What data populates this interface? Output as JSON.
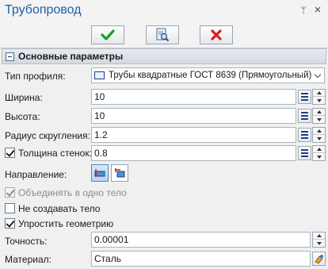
{
  "window": {
    "title": "Трубопровод",
    "pin_glyph": "ᛘ",
    "close_glyph": "×"
  },
  "toolbar": {
    "ok_icon": "checkmark-icon",
    "preview_icon": "preview-icon",
    "cancel_icon": "cross-icon"
  },
  "section": {
    "title": "Основные параметры"
  },
  "fields": {
    "profile_type": {
      "label": "Тип профиля:",
      "value": "Трубы квадратные ГОСТ 8639 (Прямоугольный)"
    },
    "width": {
      "label": "Ширина:",
      "value": "10"
    },
    "height": {
      "label": "Высота:",
      "value": "10"
    },
    "radius": {
      "label": "Радиус скругления:",
      "value": "1.2"
    },
    "wall": {
      "label": "Толщина стенок:",
      "value": "0.8",
      "checked": true
    },
    "direction": {
      "label": "Направление:"
    },
    "accuracy": {
      "label": "Точность:",
      "value": "0.00001"
    },
    "material": {
      "label": "Материал:",
      "value": "Сталь"
    }
  },
  "options": {
    "merge": {
      "label": "Объединять в одно тело",
      "checked": true,
      "disabled": true
    },
    "no_body": {
      "label": "Не создавать тело",
      "checked": false
    },
    "simplify": {
      "label": "Упростить геометрию",
      "checked": true
    }
  },
  "colors": {
    "title": "#1f5fa8",
    "ok": "#1e9e1e",
    "cancel": "#d42020",
    "accent": "#1f3f8a"
  }
}
